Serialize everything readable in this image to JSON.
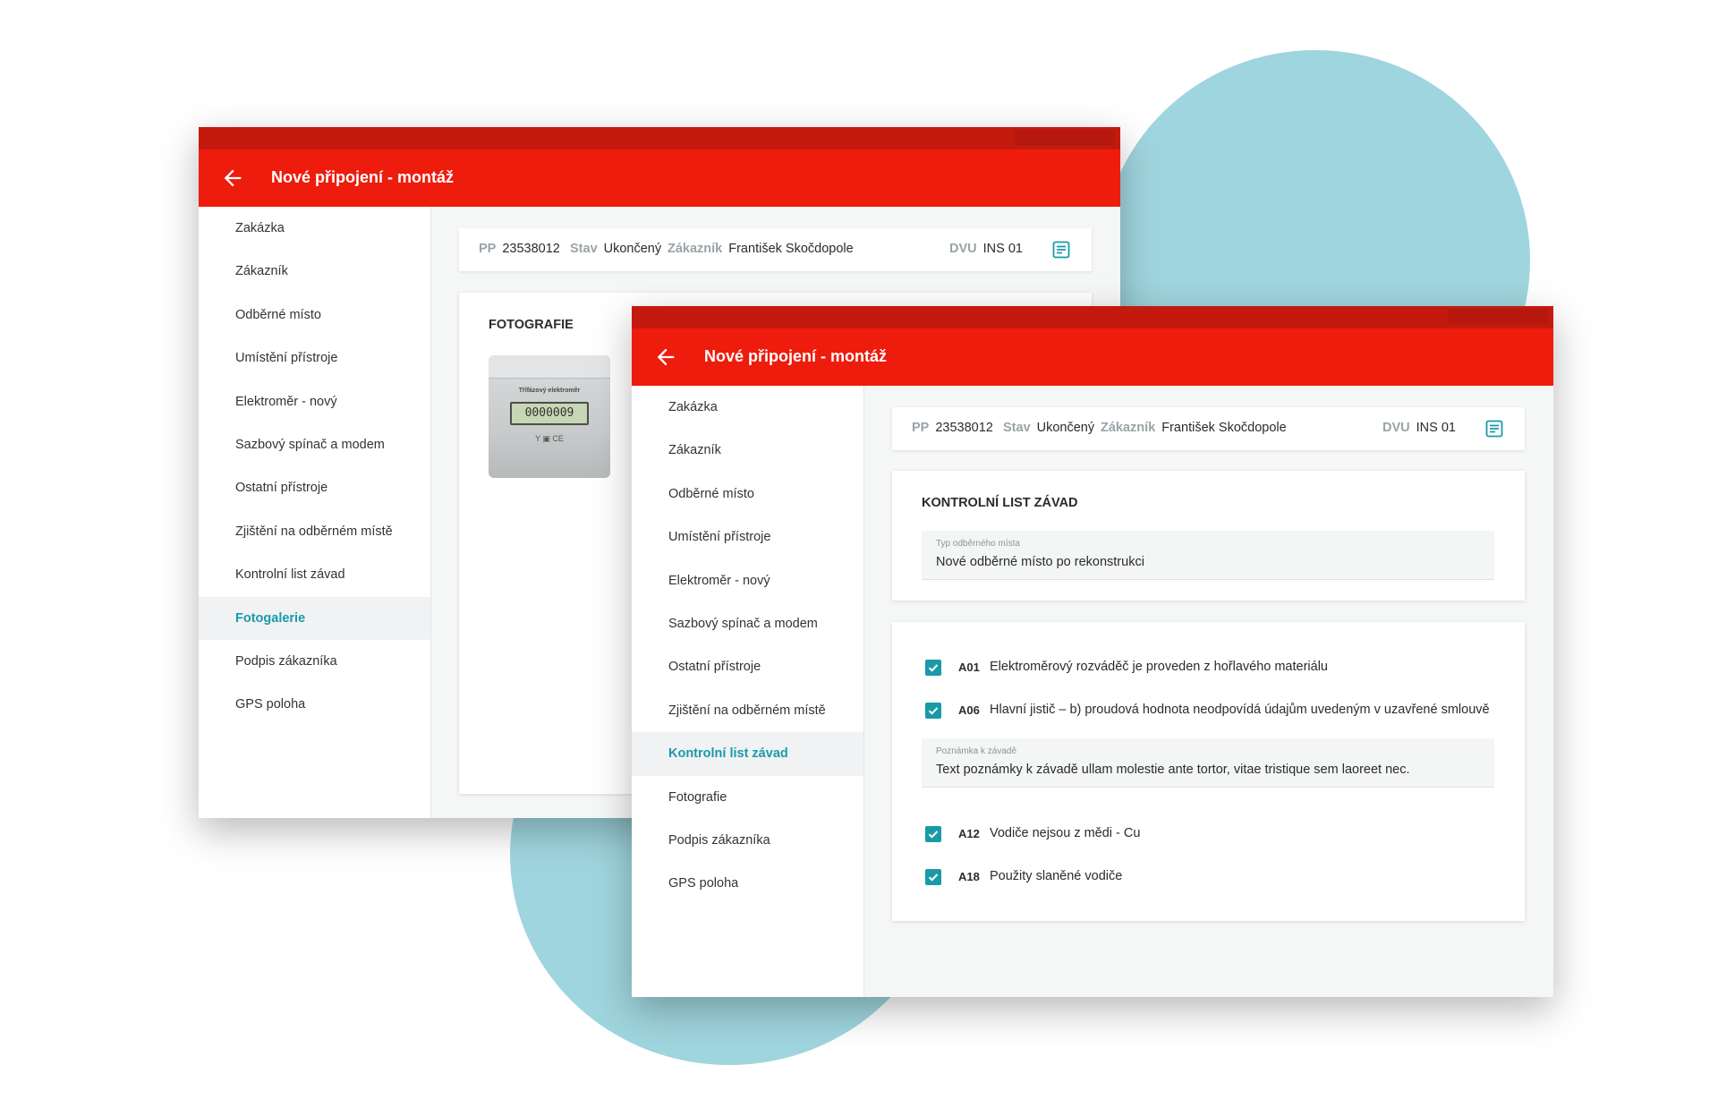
{
  "colors": {
    "brand_red": "#ee1c0c",
    "status_red": "#c41a0e",
    "accent_teal": "#1a9aa8",
    "blob": "#9fd5de"
  },
  "back_window": {
    "title": "Nové připojení - montáž",
    "nav": [
      "Zakázka",
      "Zákazník",
      "Odběrné místo",
      "Umístění přístroje",
      "Elektroměr - nový",
      "Sazbový spínač a modem",
      "Ostatní přístroje",
      "Zjištění na odběrném místě",
      "Kontrolní list závad",
      "Fotogalerie",
      "Podpis zákazníka",
      "GPS poloha"
    ],
    "active_nav": "Fotogalerie",
    "info": {
      "pp_label": "PP",
      "pp_value": "23538012",
      "stav_label": "Stav",
      "stav_value": "Ukončený",
      "zakaznik_label": "Zákazník",
      "zakaznik_value": "František Skočdopole",
      "dvu_label": "DVU",
      "dvu_value": "INS 01"
    },
    "section_title": "FOTOGRAFIE",
    "photo": {
      "caption": "Třífázový elektroměr",
      "display": "0000009",
      "marks": "Y ▣ CE"
    }
  },
  "front_window": {
    "title": "Nové připojení - montáž",
    "nav": [
      "Zakázka",
      "Zákazník",
      "Odběrné místo",
      "Umístění přístroje",
      "Elektroměr - nový",
      "Sazbový spínač a modem",
      "Ostatní přístroje",
      "Zjištění na odběrném místě",
      "Kontrolní list závad",
      "Fotografie",
      "Podpis zákazníka",
      "GPS poloha"
    ],
    "active_nav": "Kontrolní list závad",
    "info": {
      "pp_label": "PP",
      "pp_value": "23538012",
      "stav_label": "Stav",
      "stav_value": "Ukončený",
      "zakaznik_label": "Zákazník",
      "zakaznik_value": "František Skočdopole",
      "dvu_label": "DVU",
      "dvu_value": "INS 01"
    },
    "section_title": "KONTROLNÍ LIST ZÁVAD",
    "type_field": {
      "label": "Typ odběrného místa",
      "value": "Nové odběrné místo po rekonstrukci"
    },
    "defects": [
      {
        "code": "A01",
        "text": "Elektroměrový rozváděč je proveden z hořlavého materiálu",
        "checked": true
      },
      {
        "code": "A06",
        "text": "Hlavní jistič – b) proudová hodnota neodpovídá údajům uvedeným v uzavřené smlouvě",
        "checked": true
      },
      {
        "code": "A12",
        "text": "Vodiče nejsou z mědi - Cu",
        "checked": true
      },
      {
        "code": "A18",
        "text": "Použity slaněné vodiče",
        "checked": true
      }
    ],
    "note_field": {
      "label": "Poznámka k závadě",
      "value": "Text poznámky k závadě ullam molestie ante tortor, vitae tristique sem laoreet nec."
    }
  }
}
